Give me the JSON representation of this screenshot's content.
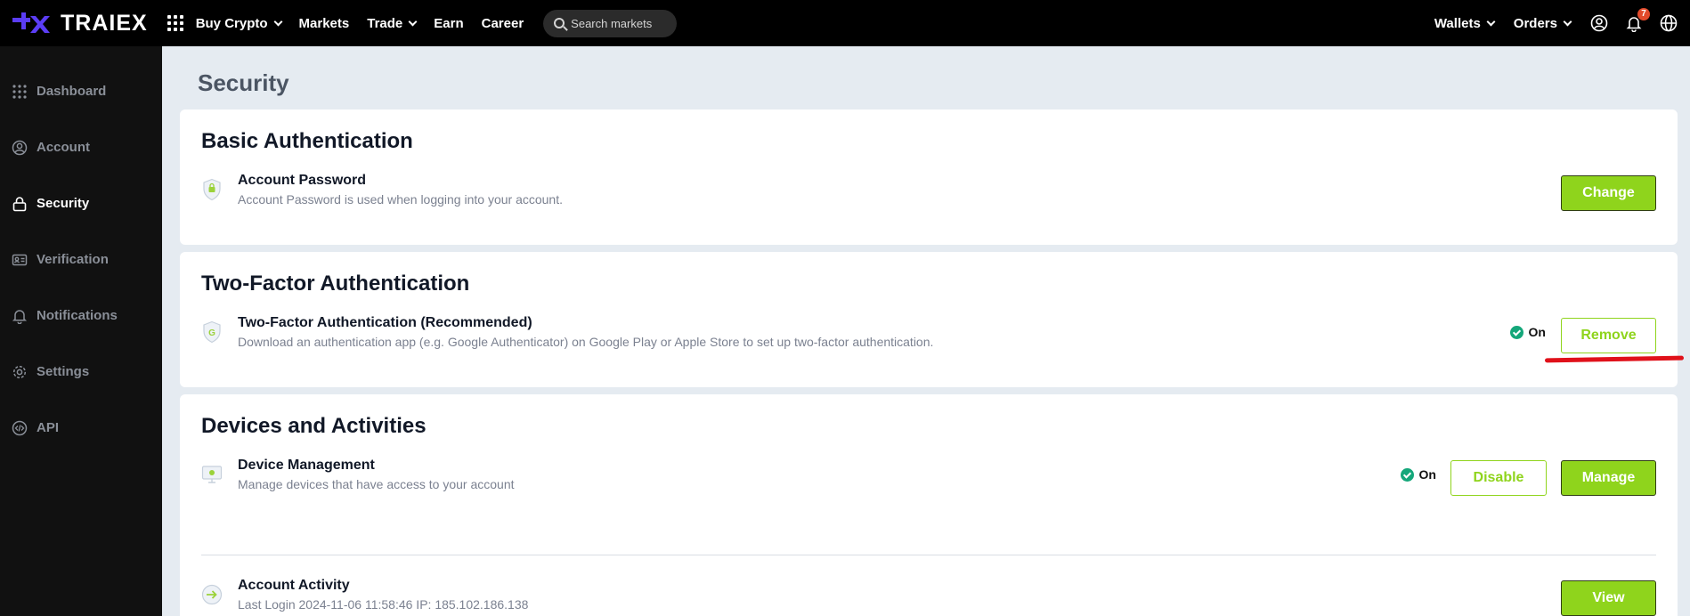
{
  "brand": {
    "name": "TRAIEX",
    "accent": "#5b3df5",
    "primary": "#8fd41c"
  },
  "topnav": {
    "items": [
      {
        "label": "Buy Crypto",
        "dropdown": true
      },
      {
        "label": "Markets",
        "dropdown": false
      },
      {
        "label": "Trade",
        "dropdown": true
      },
      {
        "label": "Earn",
        "dropdown": false
      },
      {
        "label": "Career",
        "dropdown": false
      }
    ],
    "search_placeholder": "Search markets",
    "right": {
      "wallets": "Wallets",
      "orders": "Orders",
      "notification_count": "7"
    }
  },
  "sidebar": {
    "items": [
      {
        "label": "Dashboard",
        "icon": "grid-icon",
        "active": false
      },
      {
        "label": "Account",
        "icon": "user-circle-icon",
        "active": false
      },
      {
        "label": "Security",
        "icon": "lock-icon",
        "active": true
      },
      {
        "label": "Verification",
        "icon": "id-card-icon",
        "active": false
      },
      {
        "label": "Notifications",
        "icon": "bell-icon",
        "active": false
      },
      {
        "label": "Settings",
        "icon": "gear-icon",
        "active": false
      },
      {
        "label": "API",
        "icon": "code-icon",
        "active": false
      }
    ]
  },
  "page": {
    "title": "Security"
  },
  "basic_auth": {
    "heading": "Basic Authentication",
    "password": {
      "title": "Account Password",
      "desc": "Account Password is used when logging into your account.",
      "button": "Change"
    }
  },
  "two_factor": {
    "heading": "Two-Factor Authentication",
    "item": {
      "title": "Two-Factor Authentication (Recommended)",
      "desc": "Download an authentication app (e.g. Google Authenticator) on Google Play or Apple Store to set up two-factor authentication.",
      "status": "On",
      "button": "Remove"
    }
  },
  "devices": {
    "heading": "Devices and Activities",
    "management": {
      "title": "Device Management",
      "desc": "Manage devices that have access to your account",
      "status": "On",
      "disable_button": "Disable",
      "manage_button": "Manage"
    },
    "activity": {
      "title": "Account Activity",
      "desc": "Last Login 2024-11-06 11:58:46 IP: 185.102.186.138",
      "button": "View"
    }
  }
}
